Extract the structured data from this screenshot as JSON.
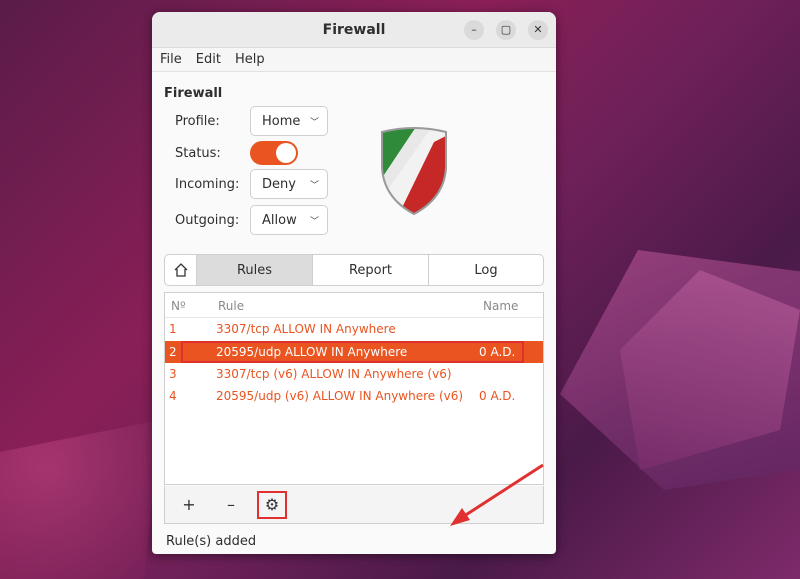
{
  "window": {
    "title": "Firewall"
  },
  "menu": {
    "items": [
      "File",
      "Edit",
      "Help"
    ]
  },
  "section": {
    "title": "Firewall"
  },
  "form": {
    "profile_label": "Profile:",
    "profile_value": "Home",
    "status_label": "Status:",
    "status_on": true,
    "incoming_label": "Incoming:",
    "incoming_value": "Deny",
    "outgoing_label": "Outgoing:",
    "outgoing_value": "Allow"
  },
  "tabs": {
    "home_icon": "home-icon",
    "rules": "Rules",
    "report": "Report",
    "log": "Log"
  },
  "rules": {
    "headers": {
      "num": "Nº",
      "rule": "Rule",
      "name": "Name"
    },
    "rows": [
      {
        "num": "1",
        "rule": "3307/tcp ALLOW IN Anywhere",
        "name": ""
      },
      {
        "num": "2",
        "rule": "20595/udp ALLOW IN Anywhere",
        "name": "0 A.D."
      },
      {
        "num": "3",
        "rule": "3307/tcp (v6) ALLOW IN Anywhere (v6)",
        "name": ""
      },
      {
        "num": "4",
        "rule": "20595/udp (v6) ALLOW IN Anywhere (v6)",
        "name": "0 A.D."
      }
    ],
    "selected_row": 1
  },
  "toolbar": {
    "add": "+",
    "remove": "–",
    "gear_icon": "gear-icon"
  },
  "status": {
    "text": "Rule(s) added"
  },
  "colors": {
    "accent": "#e95420",
    "highlight": "#e03030"
  }
}
